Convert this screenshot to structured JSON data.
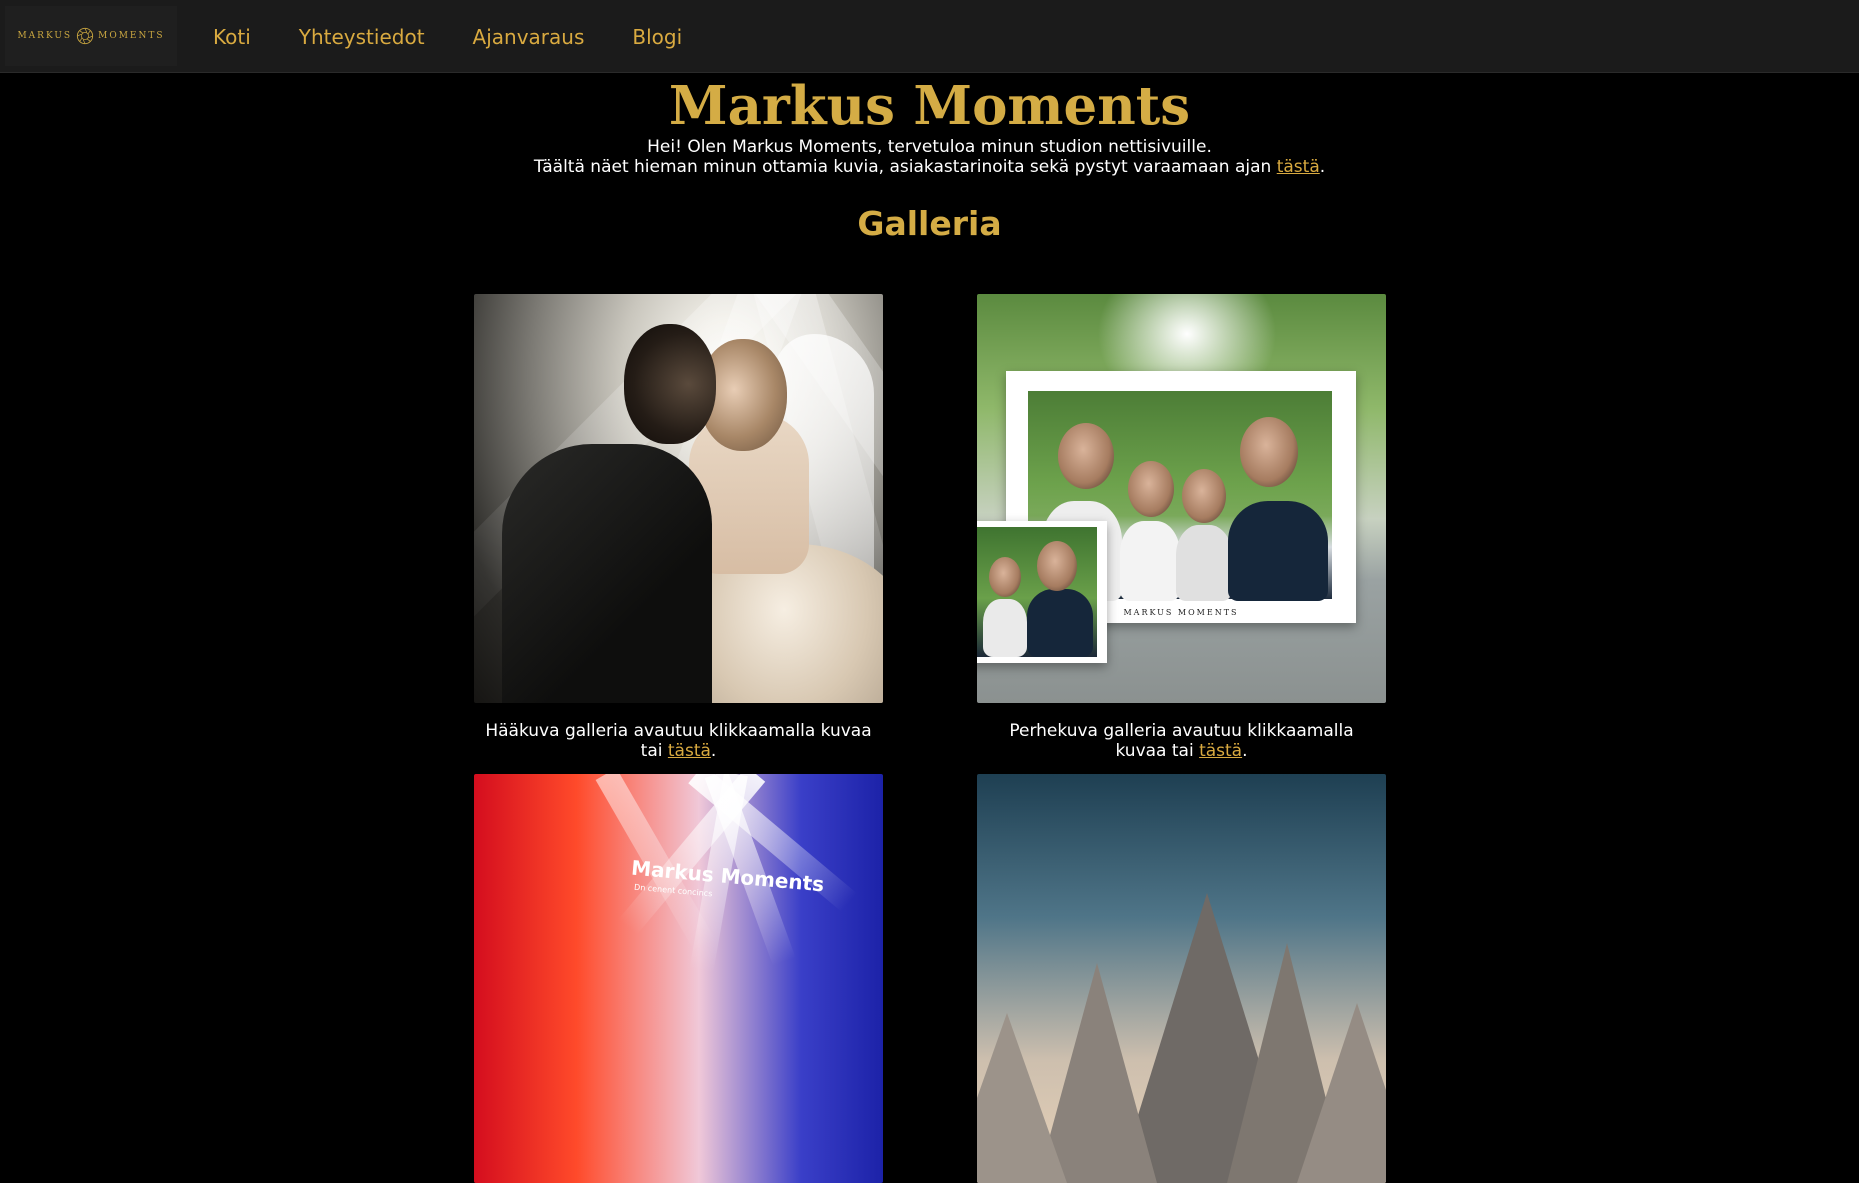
{
  "header": {
    "logo_text_left": "MARKUS",
    "logo_text_right": "MOMENTS",
    "nav": [
      {
        "label": "Koti"
      },
      {
        "label": "Yhteystiedot"
      },
      {
        "label": "Ajanvaraus"
      },
      {
        "label": "Blogi"
      }
    ]
  },
  "hero": {
    "title": "Markus Moments",
    "intro_line1": "Hei! Olen Markus Moments, tervetuloa minun studion nettisivuille.",
    "intro_line2_prefix": "Täältä näet hieman minun ottamia kuvia, asiakastarinoita sekä pystyt varaamaan ajan",
    "intro_link": "tästä",
    "intro_suffix": "."
  },
  "gallery": {
    "title": "Galleria",
    "cards": [
      {
        "caption_prefix": "Hääkuva galleria avautuu klikkaamalla kuvaa tai",
        "link": "tästä",
        "suffix": "."
      },
      {
        "caption_prefix": "Perhekuva galleria avautuu klikkaamalla kuvaa tai",
        "link": "tästä",
        "suffix": ".",
        "print_brand": "MARKUS MOMENTS"
      },
      {
        "sign_text": "Markus Moments",
        "sign_sub": "Dn cenent concincs"
      },
      {}
    ]
  },
  "colors": {
    "accent": "#d4ac45",
    "nav_link": "#d9aa40",
    "topbar": "#1b1b1b",
    "background": "#000000"
  }
}
